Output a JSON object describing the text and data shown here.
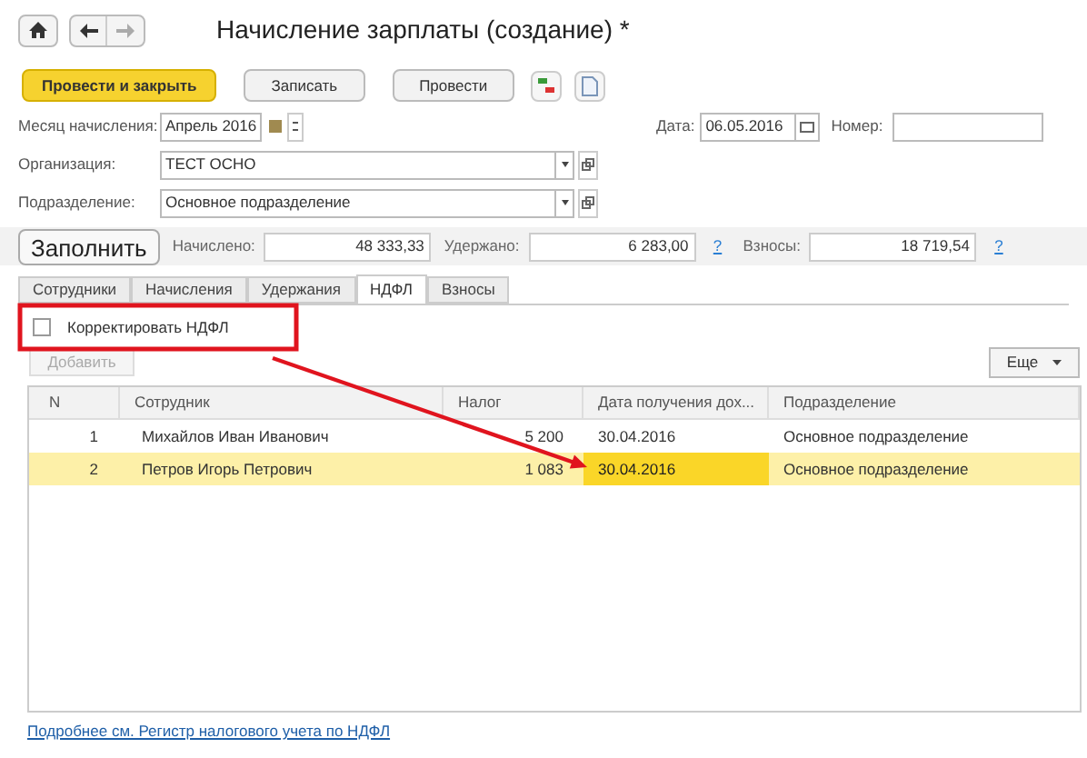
{
  "title": "Начисление зарплаты (создание) *",
  "toolbar": [
    {
      "label": "Провести и закрыть",
      "kind": "primary"
    },
    {
      "label": "Записать",
      "kind": "normal"
    },
    {
      "label": "Провести",
      "kind": "normal"
    }
  ],
  "month": {
    "label": "Месяц начисления:",
    "value": "Апрель 2016"
  },
  "date": {
    "label": "Дата:",
    "value": "06.05.2016"
  },
  "number": {
    "label": "Номер:"
  },
  "organization": {
    "label": "Организация:",
    "value": "ТЕСТ ОСНО"
  },
  "department": {
    "label": "Подразделение:",
    "value": "Основное подразделение"
  },
  "fill_button": "Заполнить",
  "totals": [
    {
      "label": "Начислено:",
      "value": "48 333,33"
    },
    {
      "label": "Удержано:",
      "value": "6 283,00",
      "help": "?"
    },
    {
      "label": "Взносы:",
      "value": "18 719,54",
      "help": "?"
    }
  ],
  "tabs": [
    {
      "label": "Сотрудники",
      "selected": false
    },
    {
      "label": "Начисления",
      "selected": false
    },
    {
      "label": "Удержания",
      "selected": false
    },
    {
      "label": "НДФЛ",
      "selected": true
    },
    {
      "label": "Взносы",
      "selected": false
    }
  ],
  "correct_checkbox": {
    "label": "Корректировать НДФЛ",
    "checked": false
  },
  "add_button": {
    "label": "Добавить",
    "disabled": true
  },
  "more_button": "Еще",
  "table": {
    "columns": [
      "N",
      "Сотрудник",
      "Налог",
      "Дата получения дох...",
      "Подразделение"
    ],
    "rows": [
      {
        "selected": false,
        "cells": [
          {
            "text": "1",
            "focused": false
          },
          {
            "text": "Михайлов Иван Иванович",
            "focused": false
          },
          {
            "text": "5 200",
            "focused": false
          },
          {
            "text": "30.04.2016",
            "focused": false
          },
          {
            "text": "Основное подразделение",
            "focused": false
          }
        ]
      },
      {
        "selected": true,
        "cells": [
          {
            "text": "2",
            "focused": false
          },
          {
            "text": "Петров Игорь Петрович",
            "focused": false
          },
          {
            "text": "1 083",
            "focused": false
          },
          {
            "text": "30.04.2016",
            "focused": true
          },
          {
            "text": "Основное подразделение",
            "focused": false
          }
        ]
      }
    ]
  },
  "footer_link": "Подробнее см. Регистр налогового учета по НДФЛ"
}
